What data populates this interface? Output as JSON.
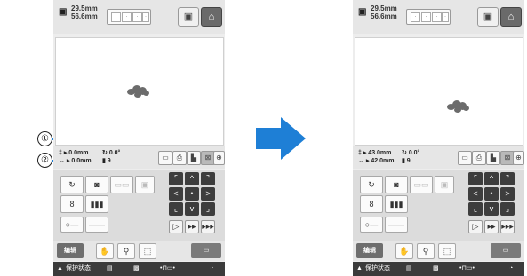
{
  "colors": {
    "accent": "#1e7fd6",
    "status_bar": "#3b3b3b"
  },
  "screens": [
    {
      "size_w": "29.5mm",
      "size_h": "56.6mm",
      "x_offset": "0.0mm",
      "y_offset": "0.0mm",
      "angle": "0.0°",
      "thread_count": "9",
      "edit_label": "编辑",
      "status_label": "保护状态",
      "end_label": ""
    },
    {
      "size_w": "29.5mm",
      "size_h": "56.6mm",
      "x_offset": "43.0mm",
      "y_offset": "42.0mm",
      "angle": "0.0°",
      "thread_count": "9",
      "edit_label": "编辑",
      "status_label": "保护状态",
      "end_label": ""
    }
  ],
  "callouts": [
    "①",
    "②"
  ],
  "arrow_icon": "right-arrow-icon"
}
